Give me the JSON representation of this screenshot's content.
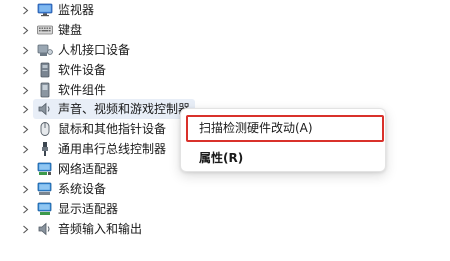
{
  "device_tree": {
    "items": [
      {
        "label": "监视器",
        "icon": "monitor-icon"
      },
      {
        "label": "键盘",
        "icon": "keyboard-icon"
      },
      {
        "label": "人机接口设备",
        "icon": "hid-icon"
      },
      {
        "label": "软件设备",
        "icon": "software-device-icon"
      },
      {
        "label": "软件组件",
        "icon": "software-component-icon"
      },
      {
        "label": "声音、视频和游戏控制器",
        "icon": "speaker-icon",
        "selected": true
      },
      {
        "label": "鼠标和其他指针设备",
        "icon": "mouse-icon"
      },
      {
        "label": "通用串行总线控制器",
        "icon": "usb-icon"
      },
      {
        "label": "网络适配器",
        "icon": "network-adapter-icon"
      },
      {
        "label": "系统设备",
        "icon": "system-device-icon"
      },
      {
        "label": "显示适配器",
        "icon": "display-adapter-icon"
      },
      {
        "label": "音频输入和输出",
        "icon": "audio-io-icon"
      }
    ]
  },
  "context_menu": {
    "scan_label": "扫描检测硬件改动(A)",
    "properties_label": "属性(R)"
  },
  "colors": {
    "highlight": "#d9312b",
    "selection": "#e8eef7"
  }
}
